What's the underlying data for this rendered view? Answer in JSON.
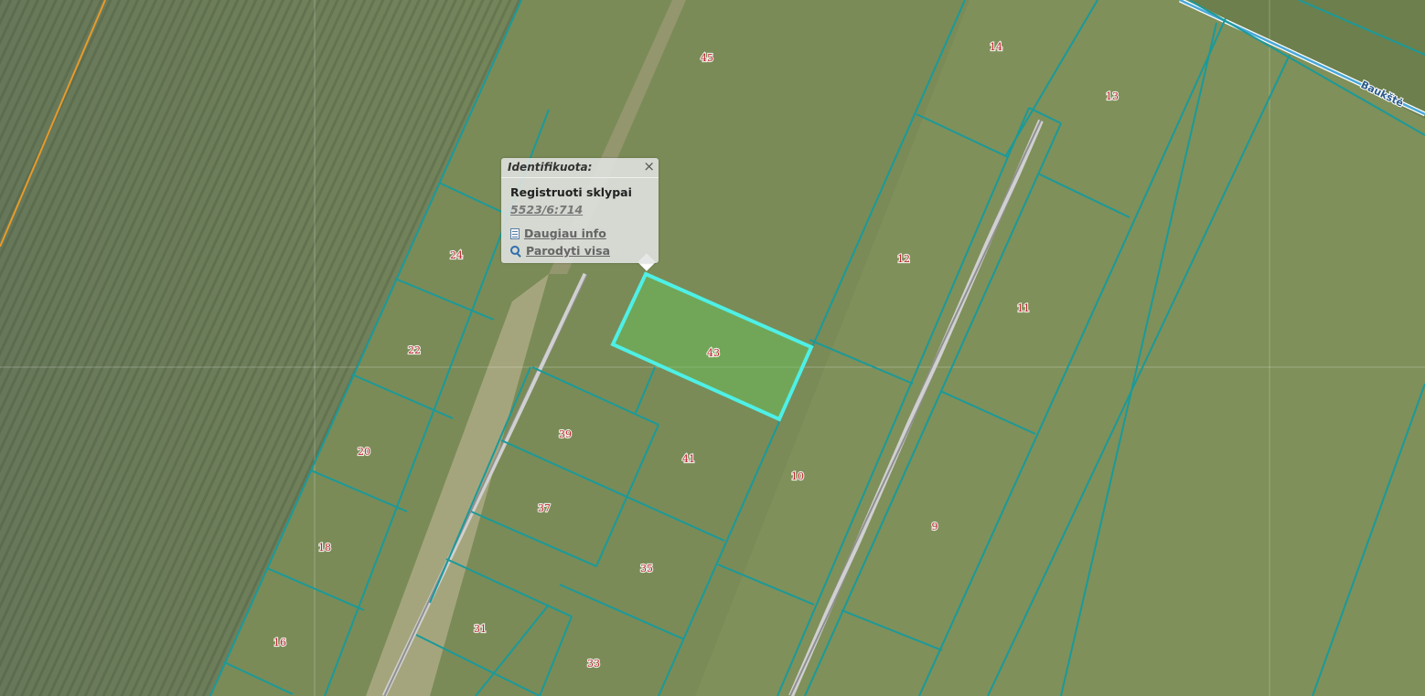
{
  "popup": {
    "title": "Identifikuota:",
    "close_symbol": "×",
    "layer_name": "Registruoti sklypai",
    "parcel_id": "5523/6:714",
    "more_info_label": "Daugiau info",
    "show_all_label": "Parodyti visa",
    "more_info_icon": "document-icon",
    "show_all_icon": "magnifier-icon"
  },
  "map": {
    "road_label": "Baukštė",
    "selected_parcel_number": "43",
    "parcel_numbers": [
      "45",
      "14",
      "13",
      "24",
      "12",
      "11",
      "22",
      "39",
      "41",
      "10",
      "20",
      "37",
      "9",
      "18",
      "35",
      "31",
      "16",
      "33"
    ],
    "colors": {
      "parcel_boundary": "#1a9a9a",
      "selected_outline": "#4ef0e6",
      "selected_fill": "#66c85a",
      "parcel_label": "#c0262c",
      "boundary_orange": "#e89a2a"
    }
  }
}
